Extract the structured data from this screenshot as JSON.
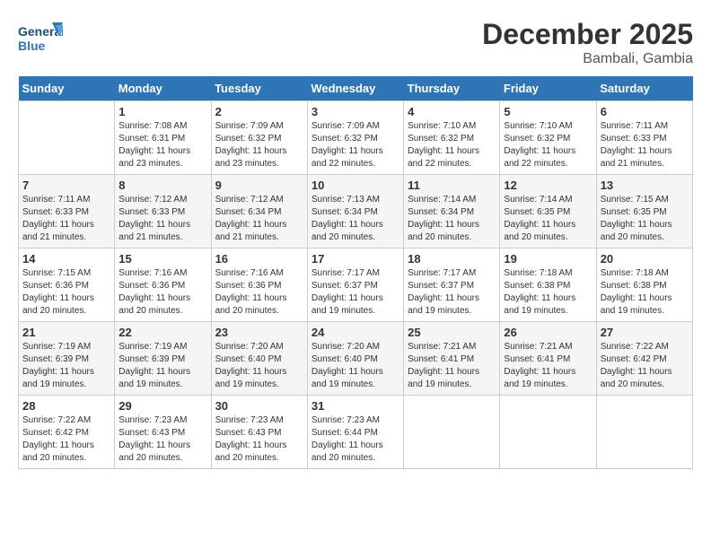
{
  "header": {
    "logo_text_1": "General",
    "logo_text_2": "Blue",
    "month": "December 2025",
    "location": "Bambali, Gambia"
  },
  "days_of_week": [
    "Sunday",
    "Monday",
    "Tuesday",
    "Wednesday",
    "Thursday",
    "Friday",
    "Saturday"
  ],
  "weeks": [
    [
      {
        "day": "",
        "sunrise": "",
        "sunset": "",
        "daylight": ""
      },
      {
        "day": "1",
        "sunrise": "Sunrise: 7:08 AM",
        "sunset": "Sunset: 6:31 PM",
        "daylight": "Daylight: 11 hours and 23 minutes."
      },
      {
        "day": "2",
        "sunrise": "Sunrise: 7:09 AM",
        "sunset": "Sunset: 6:32 PM",
        "daylight": "Daylight: 11 hours and 23 minutes."
      },
      {
        "day": "3",
        "sunrise": "Sunrise: 7:09 AM",
        "sunset": "Sunset: 6:32 PM",
        "daylight": "Daylight: 11 hours and 22 minutes."
      },
      {
        "day": "4",
        "sunrise": "Sunrise: 7:10 AM",
        "sunset": "Sunset: 6:32 PM",
        "daylight": "Daylight: 11 hours and 22 minutes."
      },
      {
        "day": "5",
        "sunrise": "Sunrise: 7:10 AM",
        "sunset": "Sunset: 6:32 PM",
        "daylight": "Daylight: 11 hours and 22 minutes."
      },
      {
        "day": "6",
        "sunrise": "Sunrise: 7:11 AM",
        "sunset": "Sunset: 6:33 PM",
        "daylight": "Daylight: 11 hours and 21 minutes."
      }
    ],
    [
      {
        "day": "7",
        "sunrise": "Sunrise: 7:11 AM",
        "sunset": "Sunset: 6:33 PM",
        "daylight": "Daylight: 11 hours and 21 minutes."
      },
      {
        "day": "8",
        "sunrise": "Sunrise: 7:12 AM",
        "sunset": "Sunset: 6:33 PM",
        "daylight": "Daylight: 11 hours and 21 minutes."
      },
      {
        "day": "9",
        "sunrise": "Sunrise: 7:12 AM",
        "sunset": "Sunset: 6:34 PM",
        "daylight": "Daylight: 11 hours and 21 minutes."
      },
      {
        "day": "10",
        "sunrise": "Sunrise: 7:13 AM",
        "sunset": "Sunset: 6:34 PM",
        "daylight": "Daylight: 11 hours and 20 minutes."
      },
      {
        "day": "11",
        "sunrise": "Sunrise: 7:14 AM",
        "sunset": "Sunset: 6:34 PM",
        "daylight": "Daylight: 11 hours and 20 minutes."
      },
      {
        "day": "12",
        "sunrise": "Sunrise: 7:14 AM",
        "sunset": "Sunset: 6:35 PM",
        "daylight": "Daylight: 11 hours and 20 minutes."
      },
      {
        "day": "13",
        "sunrise": "Sunrise: 7:15 AM",
        "sunset": "Sunset: 6:35 PM",
        "daylight": "Daylight: 11 hours and 20 minutes."
      }
    ],
    [
      {
        "day": "14",
        "sunrise": "Sunrise: 7:15 AM",
        "sunset": "Sunset: 6:36 PM",
        "daylight": "Daylight: 11 hours and 20 minutes."
      },
      {
        "day": "15",
        "sunrise": "Sunrise: 7:16 AM",
        "sunset": "Sunset: 6:36 PM",
        "daylight": "Daylight: 11 hours and 20 minutes."
      },
      {
        "day": "16",
        "sunrise": "Sunrise: 7:16 AM",
        "sunset": "Sunset: 6:36 PM",
        "daylight": "Daylight: 11 hours and 20 minutes."
      },
      {
        "day": "17",
        "sunrise": "Sunrise: 7:17 AM",
        "sunset": "Sunset: 6:37 PM",
        "daylight": "Daylight: 11 hours and 19 minutes."
      },
      {
        "day": "18",
        "sunrise": "Sunrise: 7:17 AM",
        "sunset": "Sunset: 6:37 PM",
        "daylight": "Daylight: 11 hours and 19 minutes."
      },
      {
        "day": "19",
        "sunrise": "Sunrise: 7:18 AM",
        "sunset": "Sunset: 6:38 PM",
        "daylight": "Daylight: 11 hours and 19 minutes."
      },
      {
        "day": "20",
        "sunrise": "Sunrise: 7:18 AM",
        "sunset": "Sunset: 6:38 PM",
        "daylight": "Daylight: 11 hours and 19 minutes."
      }
    ],
    [
      {
        "day": "21",
        "sunrise": "Sunrise: 7:19 AM",
        "sunset": "Sunset: 6:39 PM",
        "daylight": "Daylight: 11 hours and 19 minutes."
      },
      {
        "day": "22",
        "sunrise": "Sunrise: 7:19 AM",
        "sunset": "Sunset: 6:39 PM",
        "daylight": "Daylight: 11 hours and 19 minutes."
      },
      {
        "day": "23",
        "sunrise": "Sunrise: 7:20 AM",
        "sunset": "Sunset: 6:40 PM",
        "daylight": "Daylight: 11 hours and 19 minutes."
      },
      {
        "day": "24",
        "sunrise": "Sunrise: 7:20 AM",
        "sunset": "Sunset: 6:40 PM",
        "daylight": "Daylight: 11 hours and 19 minutes."
      },
      {
        "day": "25",
        "sunrise": "Sunrise: 7:21 AM",
        "sunset": "Sunset: 6:41 PM",
        "daylight": "Daylight: 11 hours and 19 minutes."
      },
      {
        "day": "26",
        "sunrise": "Sunrise: 7:21 AM",
        "sunset": "Sunset: 6:41 PM",
        "daylight": "Daylight: 11 hours and 19 minutes."
      },
      {
        "day": "27",
        "sunrise": "Sunrise: 7:22 AM",
        "sunset": "Sunset: 6:42 PM",
        "daylight": "Daylight: 11 hours and 20 minutes."
      }
    ],
    [
      {
        "day": "28",
        "sunrise": "Sunrise: 7:22 AM",
        "sunset": "Sunset: 6:42 PM",
        "daylight": "Daylight: 11 hours and 20 minutes."
      },
      {
        "day": "29",
        "sunrise": "Sunrise: 7:23 AM",
        "sunset": "Sunset: 6:43 PM",
        "daylight": "Daylight: 11 hours and 20 minutes."
      },
      {
        "day": "30",
        "sunrise": "Sunrise: 7:23 AM",
        "sunset": "Sunset: 6:43 PM",
        "daylight": "Daylight: 11 hours and 20 minutes."
      },
      {
        "day": "31",
        "sunrise": "Sunrise: 7:23 AM",
        "sunset": "Sunset: 6:44 PM",
        "daylight": "Daylight: 11 hours and 20 minutes."
      },
      {
        "day": "",
        "sunrise": "",
        "sunset": "",
        "daylight": ""
      },
      {
        "day": "",
        "sunrise": "",
        "sunset": "",
        "daylight": ""
      },
      {
        "day": "",
        "sunrise": "",
        "sunset": "",
        "daylight": ""
      }
    ]
  ]
}
